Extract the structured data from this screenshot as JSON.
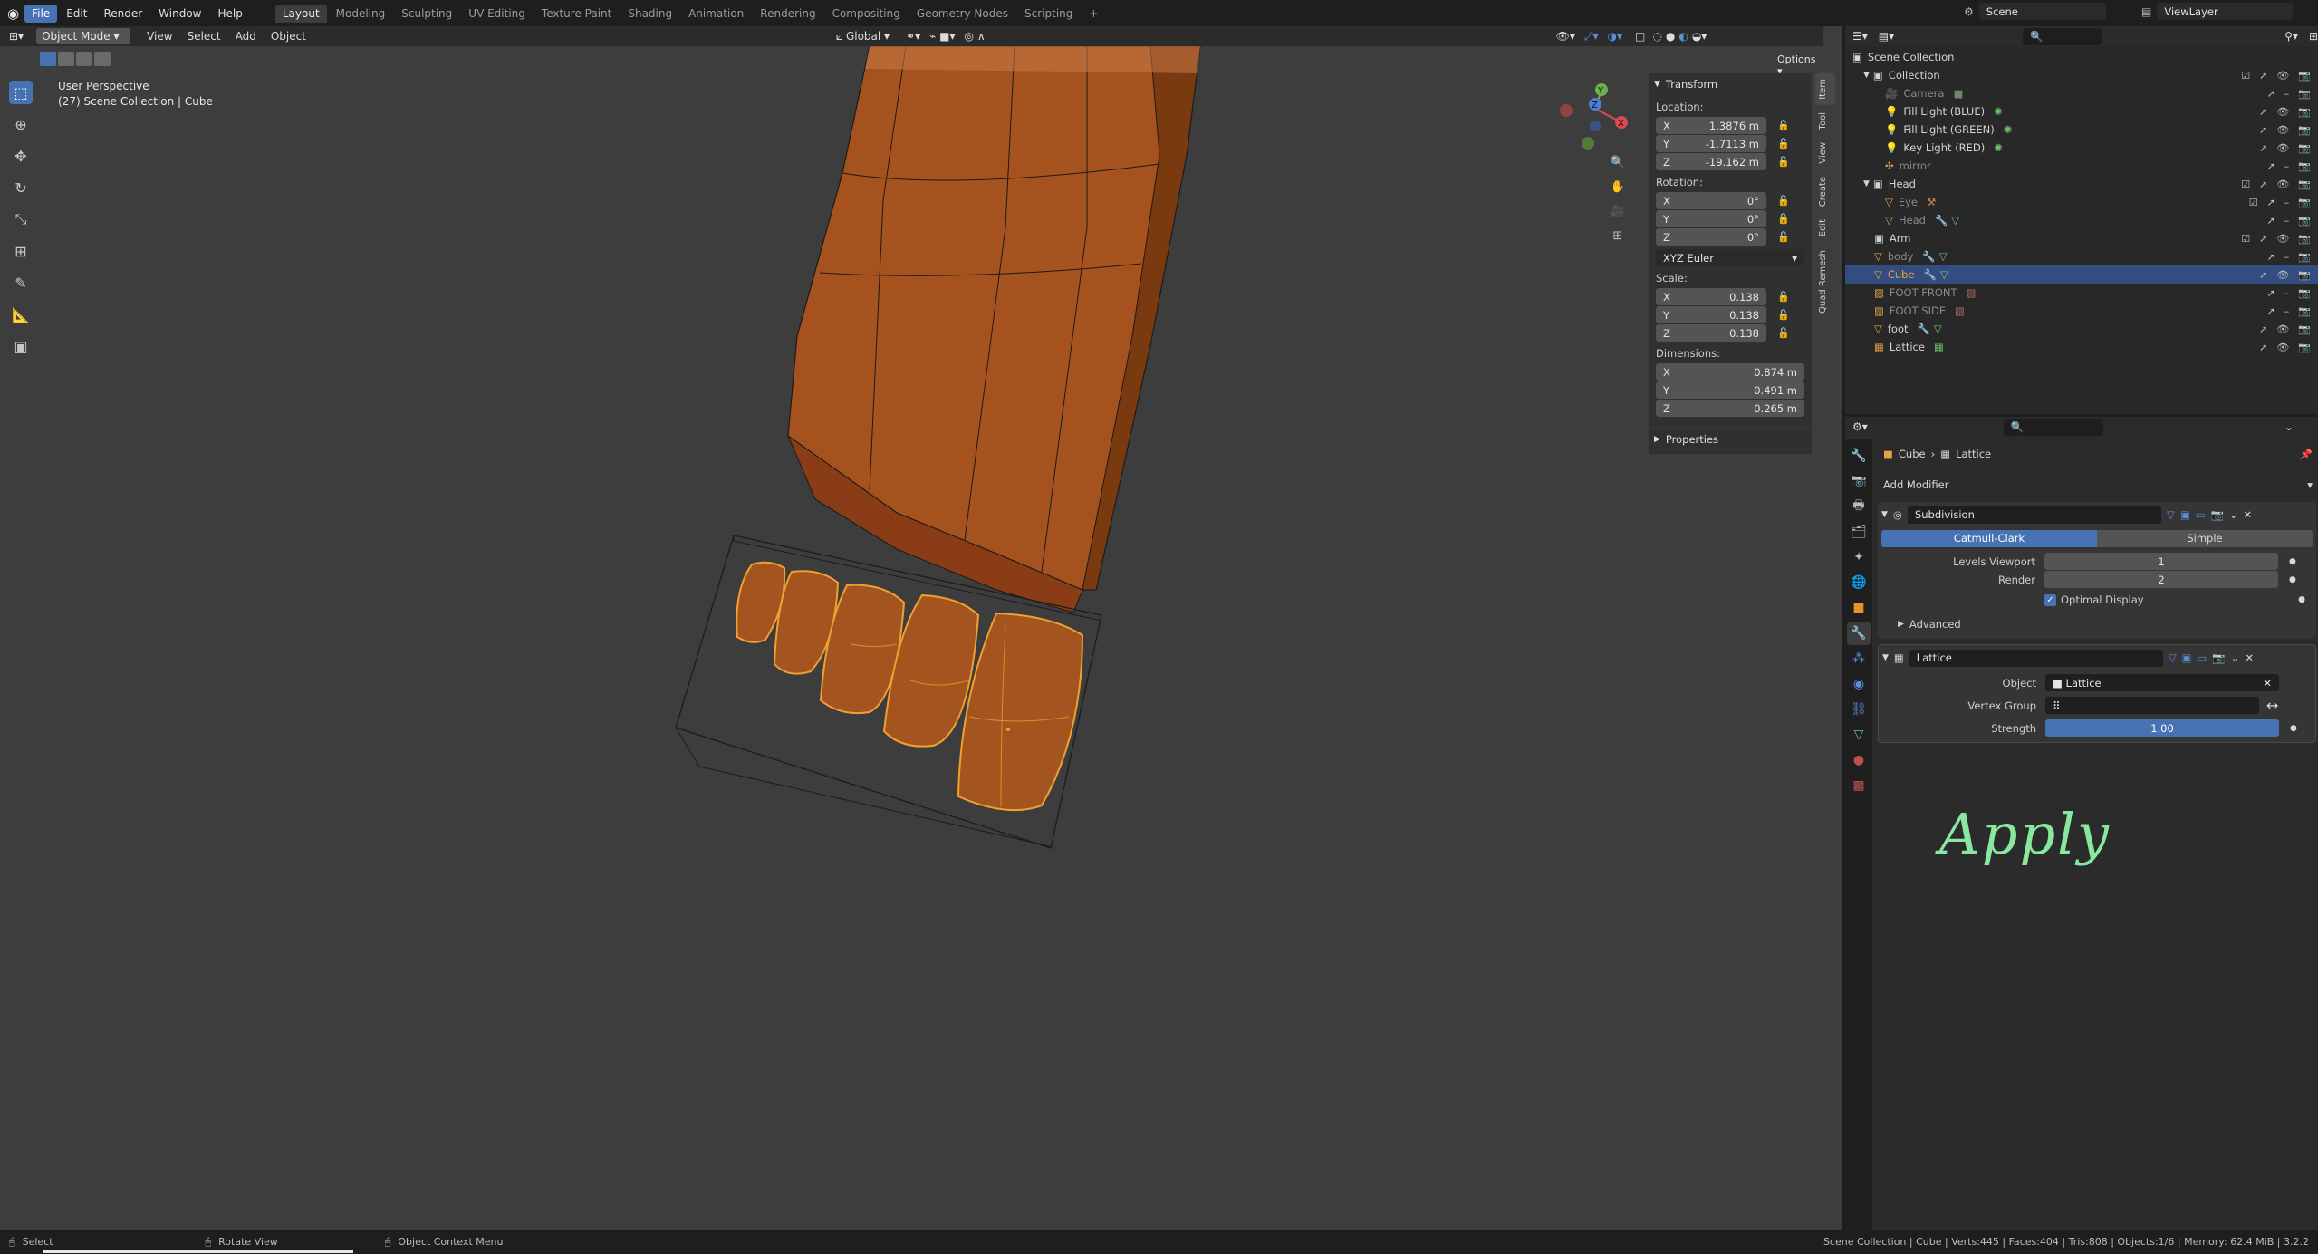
{
  "menu": [
    "File",
    "Edit",
    "Render",
    "Window",
    "Help"
  ],
  "workspaces": [
    "Layout",
    "Modeling",
    "Sculpting",
    "UV Editing",
    "Texture Paint",
    "Shading",
    "Animation",
    "Rendering",
    "Compositing",
    "Geometry Nodes",
    "Scripting"
  ],
  "scene_name": "Scene",
  "view_layer": "ViewLayer",
  "viewport_header": {
    "mode": "Object Mode",
    "view": "View",
    "select": "Select",
    "add": "Add",
    "object": "Object",
    "orientation": "Global",
    "options": "Options"
  },
  "viewport_info": {
    "perspective": "User Perspective",
    "collection": "(27) Scene Collection | Cube"
  },
  "npanel": {
    "section": "Transform",
    "location_label": "Location:",
    "location": {
      "x": "1.3876 m",
      "y": "-1.7113 m",
      "z": "-19.162 m"
    },
    "rotation_label": "Rotation:",
    "rotation": {
      "x": "0°",
      "y": "0°",
      "z": "0°"
    },
    "rotation_mode": "XYZ Euler",
    "scale_label": "Scale:",
    "scale": {
      "x": "0.138",
      "y": "0.138",
      "z": "0.138"
    },
    "dimensions_label": "Dimensions:",
    "dimensions": {
      "x": "0.874 m",
      "y": "0.491 m",
      "z": "0.265 m"
    },
    "axis": {
      "x": "X",
      "y": "Y",
      "z": "Z"
    },
    "properties": "Properties",
    "tabs": [
      "Item",
      "Tool",
      "View",
      "Create",
      "Edit",
      "Quad Remesh"
    ]
  },
  "outliner": {
    "rows": [
      {
        "name": "Scene Collection",
        "indent": 0
      },
      {
        "name": "Collection",
        "indent": 1
      },
      {
        "name": "Camera",
        "indent": 2
      },
      {
        "name": "Fill Light (BLUE)",
        "indent": 2
      },
      {
        "name": "Fill Light (GREEN)",
        "indent": 2
      },
      {
        "name": "Key Light (RED)",
        "indent": 2
      },
      {
        "name": "mirror",
        "indent": 2
      },
      {
        "name": "Head",
        "indent": 1
      },
      {
        "name": "Eye",
        "indent": 2
      },
      {
        "name": "Head",
        "indent": 2
      },
      {
        "name": "Arm",
        "indent": 1
      },
      {
        "name": "body",
        "indent": 1
      },
      {
        "name": "Cube",
        "indent": 1,
        "selected": true
      },
      {
        "name": "FOOT FRONT",
        "indent": 1
      },
      {
        "name": "FOOT SIDE",
        "indent": 1
      },
      {
        "name": "foot",
        "indent": 1
      },
      {
        "name": "Lattice",
        "indent": 1
      }
    ]
  },
  "properties": {
    "breadcrumb_object": "Cube",
    "breadcrumb_modifier": "Lattice",
    "add_modifier": "Add Modifier",
    "subdivision": {
      "name": "Subdivision",
      "catmull": "Catmull-Clark",
      "simple": "Simple",
      "levels_viewport_label": "Levels Viewport",
      "levels_viewport": "1",
      "render_label": "Render",
      "render": "2",
      "optimal_display": "Optimal Display",
      "advanced": "Advanced"
    },
    "lattice": {
      "name": "Lattice",
      "object_label": "Object",
      "object": "Lattice",
      "vertex_group_label": "Vertex Group",
      "strength_label": "Strength",
      "strength": "1.00"
    }
  },
  "annotation": "Apply",
  "status_bar": {
    "select": "Select",
    "rotate": "Rotate View",
    "context": "Object Context Menu",
    "stats": "Scene Collection | Cube | Verts:445 | Faces:404 | Tris:808 | Objects:1/6 | Memory: 62.4 MiB | 3.2.2"
  },
  "colors": {
    "accent": "#4772b3",
    "selection": "#e8912d",
    "handwriting": "#88e8a0"
  }
}
